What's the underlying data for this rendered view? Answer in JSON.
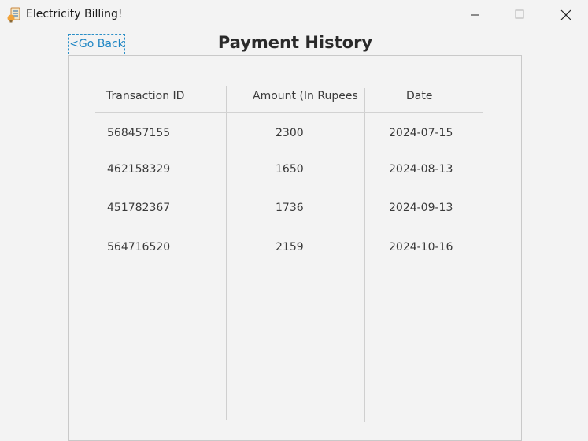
{
  "window": {
    "title": "Electricity Billing!",
    "icon": "bulb-bill-icon"
  },
  "nav": {
    "go_back_label": "<Go Back"
  },
  "page": {
    "title": "Payment History"
  },
  "table": {
    "columns": [
      "Transaction ID",
      "Amount (In Rupees",
      "Date"
    ],
    "rows": [
      {
        "id": "568457155",
        "amount": "2300",
        "date": "2024-07-15"
      },
      {
        "id": "462158329",
        "amount": "1650",
        "date": "2024-08-13"
      },
      {
        "id": "451782367",
        "amount": "1736",
        "date": "2024-09-13"
      },
      {
        "id": "564716520",
        "amount": "2159",
        "date": "2024-10-16"
      }
    ]
  },
  "colors": {
    "link": "#1f86c4",
    "background": "#f3f3f3"
  }
}
